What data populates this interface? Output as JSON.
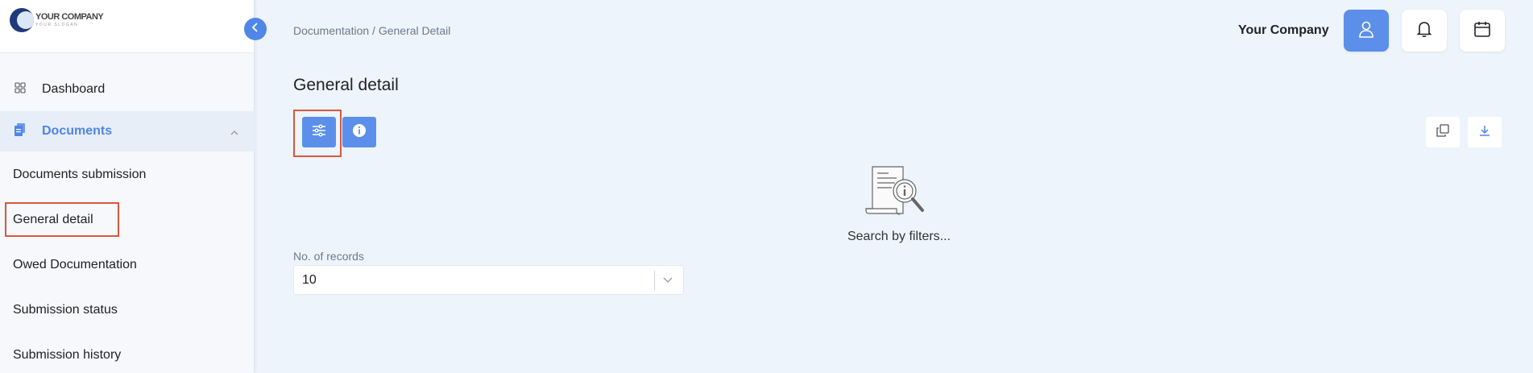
{
  "brand": {
    "name": "YOUR COMPANY",
    "slogan": "YOUR SLOGAN"
  },
  "sidebar": {
    "dashboard_label": "Dashboard",
    "documents_label": "Documents",
    "sub_items": [
      "Documents submission",
      "General detail",
      "Owed Documentation",
      "Submission status",
      "Submission history"
    ],
    "active_sub_item": "General detail"
  },
  "header": {
    "breadcrumb": "Documentation / General Detail",
    "company_name": "Your Company"
  },
  "main": {
    "title": "General detail",
    "empty_state_text": "Search by filters...",
    "records_label": "No. of records",
    "records_value": "10"
  },
  "colors": {
    "accent": "#5b8fea",
    "highlight": "#d9573f",
    "background": "#eef4fb"
  },
  "icons": {
    "dashboard": "grid-icon",
    "documents": "documents-icon",
    "collapse": "chevron-left-icon",
    "user": "user-icon",
    "bell": "bell-icon",
    "calendar": "calendar-icon",
    "filter": "sliders-icon",
    "info": "info-icon",
    "copy": "copy-icon",
    "download": "download-icon"
  }
}
